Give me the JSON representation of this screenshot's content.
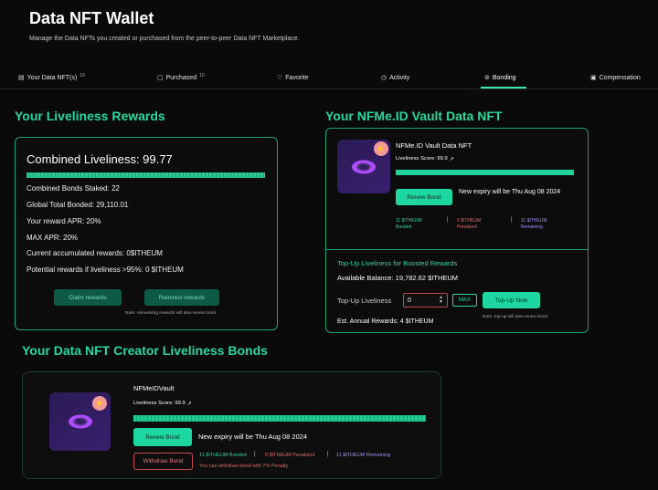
{
  "header": {
    "title": "Data NFT Wallet",
    "subtitle": "Manage the Data NFTs you created or purchased from the peer-to-peer Data NFT Marketplace."
  },
  "tabs": [
    {
      "label": "Your Data NFT(s)",
      "count": "19",
      "icon": "data-icon"
    },
    {
      "label": "Purchased",
      "count": "10",
      "icon": "bag-icon"
    },
    {
      "label": "Favorite",
      "count": "",
      "icon": "heart-icon"
    },
    {
      "label": "Activity",
      "count": "",
      "icon": "clock-icon"
    },
    {
      "label": "Bonding",
      "count": "",
      "icon": "lock-icon",
      "active": true
    },
    {
      "label": "Compensation",
      "count": "",
      "icon": "wallet-icon"
    }
  ],
  "rewards": {
    "heading": "Your Liveliness Rewards",
    "combined": "Combined Liveliness: 99.77",
    "combined_pct": 0.998,
    "lines": [
      "Combined Bonds Staked: 22",
      "Global Total Bonded: 29,110.01",
      "Your reward APR: 20%",
      "MAX APR: 20%",
      "Current accumulated rewards: 0$ITHEUM",
      "Potential rewards if liveliness >95%: 0 $ITHEUM"
    ],
    "claim_label": "Claim rewards",
    "reinvest_label": "Reinvest rewards",
    "note": "Note: reinvesting rewards will also renew bond"
  },
  "vault": {
    "heading": "Your NFMe.ID Vault Data NFT",
    "name": "NFMe.ID Vault Data NFT",
    "score": "Liveliness Score: 99.9",
    "score_pct": 0.999,
    "renew_label": "Renew Bond",
    "expiry": "New expiry will be Thu Aug 08 2024",
    "bonded_value": "11 $ITHEUM",
    "bonded_label": "Bonded",
    "penalized_value": "0 $ITHEUM",
    "penalized_label": "Penalized",
    "remaining_value": "11 $ITHEUM",
    "remaining_label": "Remaining",
    "topup_heading": "Top-Up Liveliness for Boosted Rewards",
    "available": "Available Balance: 19,782.62 $ITHEUM",
    "topup_label": "Top-Up Liveliness",
    "topup_value": "0",
    "max_label": "MAX",
    "topup_button": "Top-Up Now",
    "annual": "Est. Annual Rewards: 4 $ITHEUM",
    "topup_note": "Note: top-up will also renew bond",
    "colors": {
      "bonded": "#2bd69f",
      "penalized": "#e06a6a",
      "remaining": "#a78bfa"
    }
  },
  "creator": {
    "heading": "Your Data NFT Creator Liveliness Bonds",
    "name": "NFMeIDVault",
    "score": "Liveliness Score: 99.9",
    "score_pct": 0.999,
    "renew_label": "Renew Bond",
    "expiry": "New expiry will be Thu Aug 08 2024",
    "withdraw_label": "Withdraw Bond",
    "bonded": "11 $ITHEUM Bonded",
    "penalized": "0 $ITHEUM Penalized",
    "remaining": "11 $ITHEUM Remaining",
    "withdraw_note": "You can withdraw bond with 7% Penalty"
  }
}
